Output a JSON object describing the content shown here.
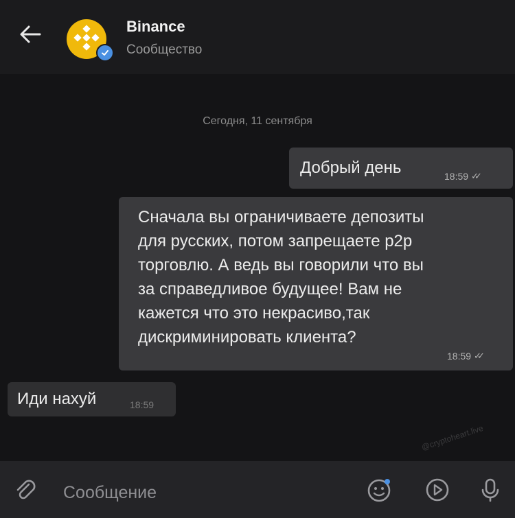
{
  "header": {
    "title": "Binance",
    "subtitle": "Сообщество",
    "back_icon": "arrow-left-icon",
    "avatar_icon": "binance-logo-icon",
    "verified_icon": "verified-check-icon",
    "accent_color": "#f0b90b"
  },
  "chat": {
    "date_separator": "Сегодня, 11 сентября",
    "messages": [
      {
        "direction": "outgoing",
        "text": "Добрый день",
        "time": "18:59",
        "status": "read"
      },
      {
        "direction": "outgoing",
        "text": "Сначала вы ограничиваете депозиты\nдля русских, потом запрещаете p2p\nторговлю. А ведь вы говорили что вы\nза справедливое будущее! Вам не\nкажется что это некрасиво,так\nдискриминировать клиента?",
        "time": "18:59",
        "status": "read"
      },
      {
        "direction": "incoming",
        "text": "Иди нахуй",
        "time": "18:59"
      }
    ],
    "watermark": "@cryptoheart.live"
  },
  "input": {
    "placeholder": "Сообщение",
    "attach_icon": "paperclip-icon",
    "emoji_icon": "emoji-icon",
    "video_icon": "play-circle-icon",
    "mic_icon": "microphone-icon"
  }
}
